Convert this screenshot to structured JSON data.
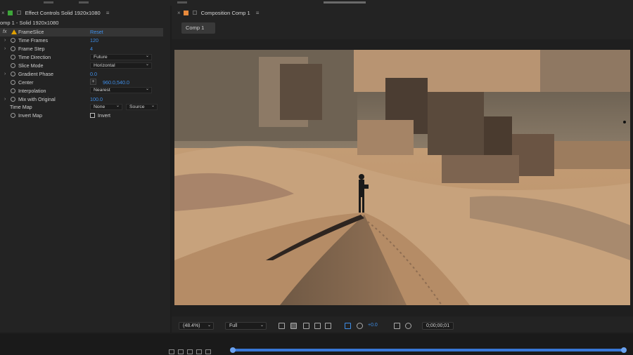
{
  "effect_controls": {
    "tab_title": "Effect Controls Solid 1920x1080",
    "layer_path": "omp 1 - Solid 1920x1080",
    "accent_color": "#3ea63a",
    "rows": {
      "frameslice": {
        "fx": "fx",
        "name": "FrameSlice",
        "value": "Reset"
      },
      "time_frames": {
        "name": "Time Frames",
        "value": "120"
      },
      "frame_step": {
        "name": "Frame Step",
        "value": "4"
      },
      "time_direction": {
        "name": "Time Direction",
        "value": "Future"
      },
      "slice_mode": {
        "name": "Slice Mode",
        "value": "Horizontal"
      },
      "gradient_phase": {
        "name": "Gradient Phase",
        "value": "0.0"
      },
      "center": {
        "name": "Center",
        "value": "960.0,540.0"
      },
      "interpolation": {
        "name": "Interpolation",
        "value": "Nearest"
      },
      "mix_with_original": {
        "name": "Mix with Original",
        "value": "100.0"
      },
      "time_map": {
        "name": "Time Map",
        "value": "None",
        "value2": "Source"
      },
      "invert_map": {
        "name": "Invert Map",
        "value": "Invert"
      }
    }
  },
  "composition": {
    "tab_title": "Composition Comp 1",
    "accent_color": "#e88a3c",
    "comp_tab": "Comp 1",
    "toolbar": {
      "zoom": "(48.4%)",
      "resolution": "Full",
      "exposure": "+0.0",
      "timecode": "0;00;00;01"
    }
  }
}
